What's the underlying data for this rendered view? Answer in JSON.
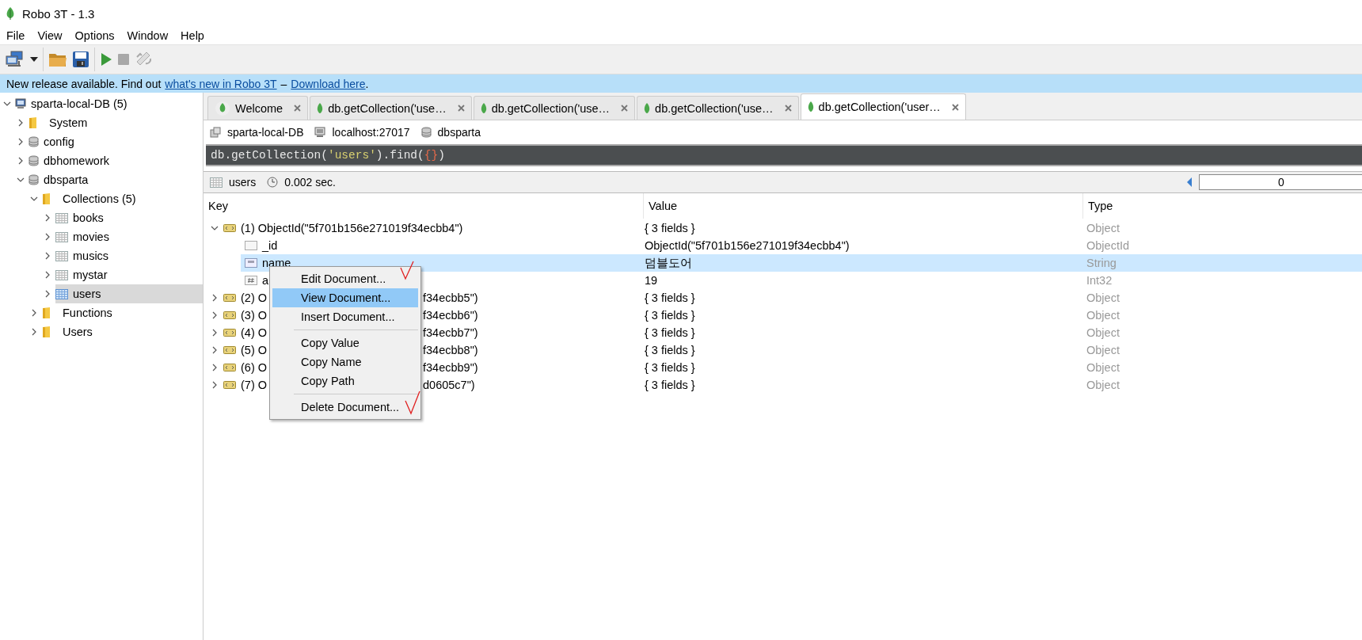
{
  "window": {
    "title": "Robo 3T - 1.3"
  },
  "menu": [
    "File",
    "View",
    "Options",
    "Window",
    "Help"
  ],
  "banner": {
    "text": "New release available. Find out",
    "link1": "what's new in Robo 3T",
    "separator": "–",
    "link2": "Download here",
    "end": "."
  },
  "tree": [
    {
      "label": "sparta-local-DB (5)",
      "kind": "server",
      "expanded": true,
      "selected": false,
      "children": [
        {
          "label": "System",
          "kind": "folder",
          "expanded": false,
          "selected": false
        },
        {
          "label": "config",
          "kind": "database",
          "expanded": false,
          "selected": false
        },
        {
          "label": "dbhomework",
          "kind": "database",
          "expanded": false,
          "selected": false
        },
        {
          "label": "dbsparta",
          "kind": "database",
          "expanded": true,
          "selected": false,
          "children": [
            {
              "label": "Collections (5)",
              "kind": "folder",
              "expanded": true,
              "selected": false,
              "children": [
                {
                  "label": "books",
                  "kind": "collection",
                  "expanded": false,
                  "selected": false
                },
                {
                  "label": "movies",
                  "kind": "collection",
                  "expanded": false,
                  "selected": false
                },
                {
                  "label": "musics",
                  "kind": "collection",
                  "expanded": false,
                  "selected": false
                },
                {
                  "label": "mystar",
                  "kind": "collection",
                  "expanded": false,
                  "selected": false
                },
                {
                  "label": "users",
                  "kind": "collection",
                  "expanded": false,
                  "selected": true
                }
              ]
            },
            {
              "label": "Functions",
              "kind": "folder",
              "expanded": false,
              "selected": false
            },
            {
              "label": "Users",
              "kind": "folder",
              "expanded": false,
              "selected": false
            }
          ]
        }
      ]
    }
  ],
  "tabs": [
    {
      "label": "Welcome",
      "kind": "welcome",
      "selected": false
    },
    {
      "label": "db.getCollection('use…",
      "kind": "query",
      "selected": false
    },
    {
      "label": "db.getCollection('use…",
      "kind": "query",
      "selected": false
    },
    {
      "label": "db.getCollection('use…",
      "kind": "query",
      "selected": false
    },
    {
      "label": "db.getCollection('user…",
      "kind": "query",
      "selected": true
    }
  ],
  "breadcrumb": [
    {
      "label": "sparta-local-DB",
      "kind": "server"
    },
    {
      "label": "localhost:27017",
      "kind": "computer"
    },
    {
      "label": "dbsparta",
      "kind": "database"
    }
  ],
  "query": [
    {
      "text": "db.getCollection(",
      "kind": "plain"
    },
    {
      "text": "'users'",
      "kind": "string"
    },
    {
      "text": ").find(",
      "kind": "plain"
    },
    {
      "text": "{}",
      "kind": "brace"
    },
    {
      "text": ")",
      "kind": "plain"
    }
  ],
  "results": {
    "collection": "users",
    "time": "0.002 sec.",
    "page": "0"
  },
  "table": {
    "columns": [
      "Key",
      "Value",
      "Type"
    ],
    "rows": [
      {
        "kind": "document",
        "key_left": "(1) ObjectId(\"5f701b156e271019f34ecbb4\")",
        "expanded": true,
        "selected": false,
        "value": "{ 3 fields }",
        "type": "Object"
      },
      {
        "kind": "id",
        "key_left": "_id",
        "selected": false,
        "value": "ObjectId(\"5f701b156e271019f34ecbb4\")",
        "type": "ObjectId"
      },
      {
        "kind": "string",
        "key_left": "name",
        "selected": true,
        "value": "덤블도어",
        "type": "String"
      },
      {
        "kind": "number",
        "key_left": "a",
        "selected": false,
        "value": "19",
        "type": "Int32"
      },
      {
        "kind": "document",
        "key_left": "(2) O",
        "key_right": "f34ecbb5\")",
        "expanded": false,
        "selected": false,
        "value": "{ 3 fields }",
        "type": "Object"
      },
      {
        "kind": "document",
        "key_left": "(3) O",
        "key_right": "f34ecbb6\")",
        "expanded": false,
        "selected": false,
        "value": "{ 3 fields }",
        "type": "Object"
      },
      {
        "kind": "document",
        "key_left": "(4) O",
        "key_right": "f34ecbb7\")",
        "expanded": false,
        "selected": false,
        "value": "{ 3 fields }",
        "type": "Object"
      },
      {
        "kind": "document",
        "key_left": "(5) O",
        "key_right": "f34ecbb8\")",
        "expanded": false,
        "selected": false,
        "value": "{ 3 fields }",
        "type": "Object"
      },
      {
        "kind": "document",
        "key_left": "(6) O",
        "key_right": "f34ecbb9\")",
        "expanded": false,
        "selected": false,
        "value": "{ 3 fields }",
        "type": "Object"
      },
      {
        "kind": "document",
        "key_left": "(7) O",
        "key_right": "d0605c7\")",
        "expanded": false,
        "selected": false,
        "value": "{ 3 fields }",
        "type": "Object"
      }
    ]
  },
  "context_menu": [
    {
      "kind": "item",
      "label": "Edit Document...",
      "selected": false
    },
    {
      "kind": "item",
      "label": "View Document...",
      "selected": true
    },
    {
      "kind": "item",
      "label": "Insert Document...",
      "selected": false
    },
    {
      "kind": "separator"
    },
    {
      "kind": "item",
      "label": "Copy Value",
      "selected": false
    },
    {
      "kind": "item",
      "label": "Copy Name",
      "selected": false
    },
    {
      "kind": "item",
      "label": "Copy Path",
      "selected": false
    },
    {
      "kind": "separator"
    },
    {
      "kind": "item",
      "label": "Delete Document...",
      "selected": false
    }
  ]
}
